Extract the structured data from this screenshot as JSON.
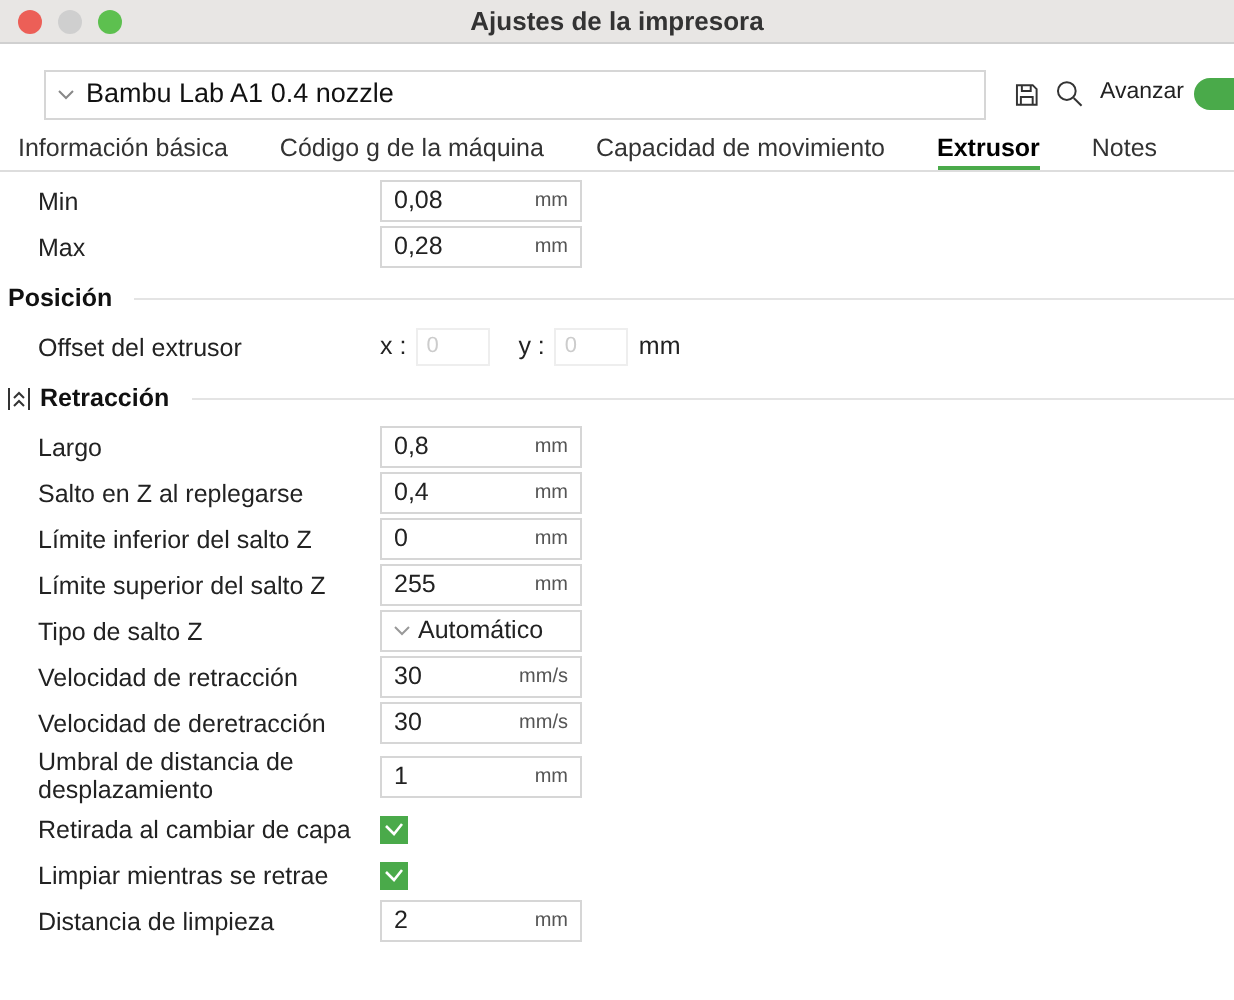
{
  "window": {
    "title": "Ajustes de la impresora"
  },
  "toolbar": {
    "preset": "Bambu Lab A1 0.4 nozzle",
    "advanced_label": "Avanzar",
    "advanced_on": true
  },
  "tabs": [
    {
      "label": "Información básica",
      "selected": false
    },
    {
      "label": "Código g de la máquina",
      "selected": false
    },
    {
      "label": "Capacidad de movimiento",
      "selected": false
    },
    {
      "label": "Extrusor",
      "selected": true
    },
    {
      "label": "Notes",
      "selected": false
    }
  ],
  "sections": [
    {
      "rows": [
        {
          "kind": "field",
          "label": "Min",
          "value": "0,08",
          "unit": "mm"
        },
        {
          "kind": "field",
          "label": "Max",
          "value": "0,28",
          "unit": "mm"
        }
      ]
    },
    {
      "title": "Posición",
      "rows": [
        {
          "kind": "offset",
          "label": "Offset del extrusor",
          "x_label": "x :",
          "x_value": "0",
          "y_label": "y :",
          "y_value": "0",
          "unit": "mm"
        }
      ]
    },
    {
      "title": "Retracción",
      "icon": true,
      "rows": [
        {
          "kind": "field",
          "label": "Largo",
          "value": "0,8",
          "unit": "mm"
        },
        {
          "kind": "field",
          "label": "Salto en Z al replegarse",
          "value": "0,4",
          "unit": "mm"
        },
        {
          "kind": "field",
          "label": "Límite inferior del salto Z",
          "value": "0",
          "unit": "mm"
        },
        {
          "kind": "field",
          "label": "Límite superior del salto Z",
          "value": "255",
          "unit": "mm"
        },
        {
          "kind": "select",
          "label": "Tipo de salto Z",
          "value": "Automático"
        },
        {
          "kind": "field",
          "label": "Velocidad de retracción",
          "value": "30",
          "unit": "mm/s"
        },
        {
          "kind": "field",
          "label": "Velocidad de deretracción",
          "value": "30",
          "unit": "mm/s"
        },
        {
          "kind": "field",
          "label": "Umbral de distancia de desplazamiento",
          "value": "1",
          "unit": "mm"
        },
        {
          "kind": "checkbox",
          "label": "Retirada al cambiar de capa",
          "checked": true
        },
        {
          "kind": "checkbox",
          "label": "Limpiar mientras se retrae",
          "checked": true
        },
        {
          "kind": "field",
          "label": "Distancia de limpieza",
          "value": "2",
          "unit": "mm"
        }
      ]
    }
  ]
}
